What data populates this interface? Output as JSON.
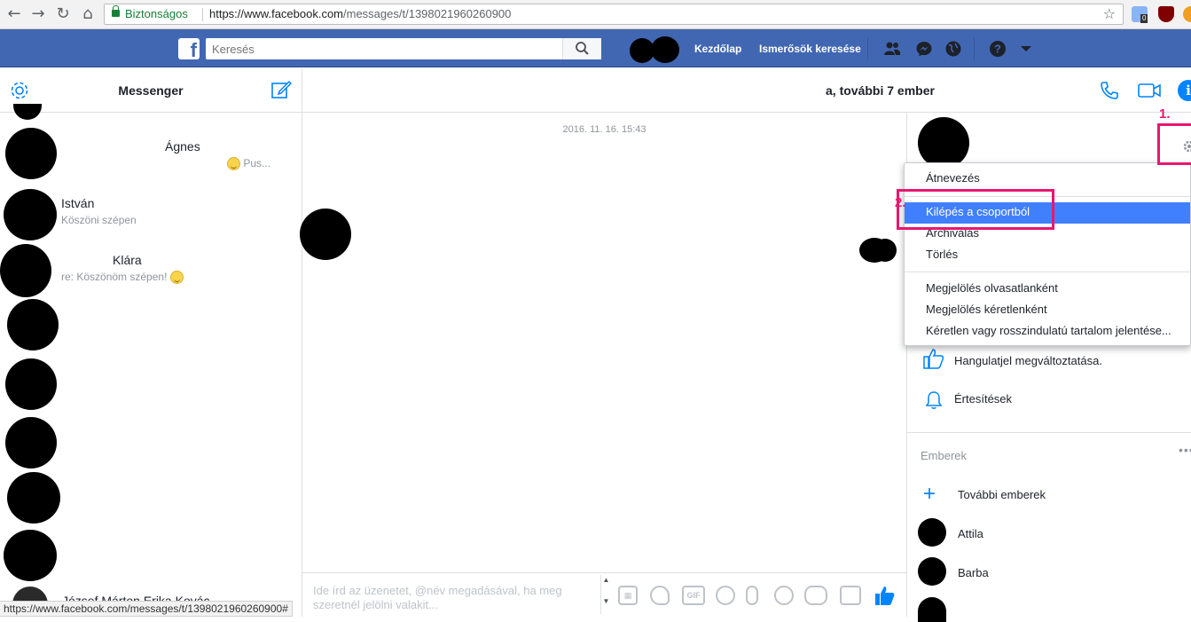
{
  "browser": {
    "secure_label": "Biztonságos",
    "url_host": "https://www.facebook.com",
    "url_path": "/messages/t/1398021960260900",
    "ext_badge": "0",
    "status_url": "https://www.facebook.com/messages/t/1398021960260900#"
  },
  "fbbar": {
    "logo": "f",
    "search_placeholder": "Keresés",
    "home_label": "Kezdőlap",
    "find_friends_label": "Ismerősök keresése"
  },
  "left": {
    "title": "Messenger",
    "conversations": [
      {
        "name": "Ágnes",
        "snippet": "Pus..."
      },
      {
        "name": "István",
        "snippet": "Köszöni szépen"
      },
      {
        "name": "Klára",
        "snippet": "re: Köszönöm szépen!"
      },
      {
        "name": "József Márton Erika Kovác",
        "snippet": ""
      }
    ]
  },
  "conversation": {
    "title": "a, további 7 ember",
    "timestamp": "2016. 11. 16. 15:43",
    "composer_placeholder": "Ide írd az üzenetet, @név megadásával, ha meg szeretnél jelölni valakit...",
    "gif_label": "GIF"
  },
  "menu": {
    "items": [
      "Átnevezés",
      "Kilépés a csoportból",
      "Archiválás",
      "Törlés",
      "Megjelölés olvasatlanként",
      "Megjelölés kéretlenként",
      "Kéretlen vagy rosszindulatú tartalom jelentése..."
    ]
  },
  "right": {
    "emoji_change": "Hangulatjel megváltoztatása.",
    "notifications": "Értesítések",
    "people_header": "Emberek",
    "add_people": "További emberek",
    "people": [
      "Attila",
      "Barba"
    ]
  },
  "annotations": {
    "step1": "1.",
    "step2": "2."
  },
  "colors": {
    "fb_blue": "#4267b2",
    "messenger_blue": "#0084ff",
    "annotation": "#e8176f",
    "menu_selected": "#4080ff"
  }
}
